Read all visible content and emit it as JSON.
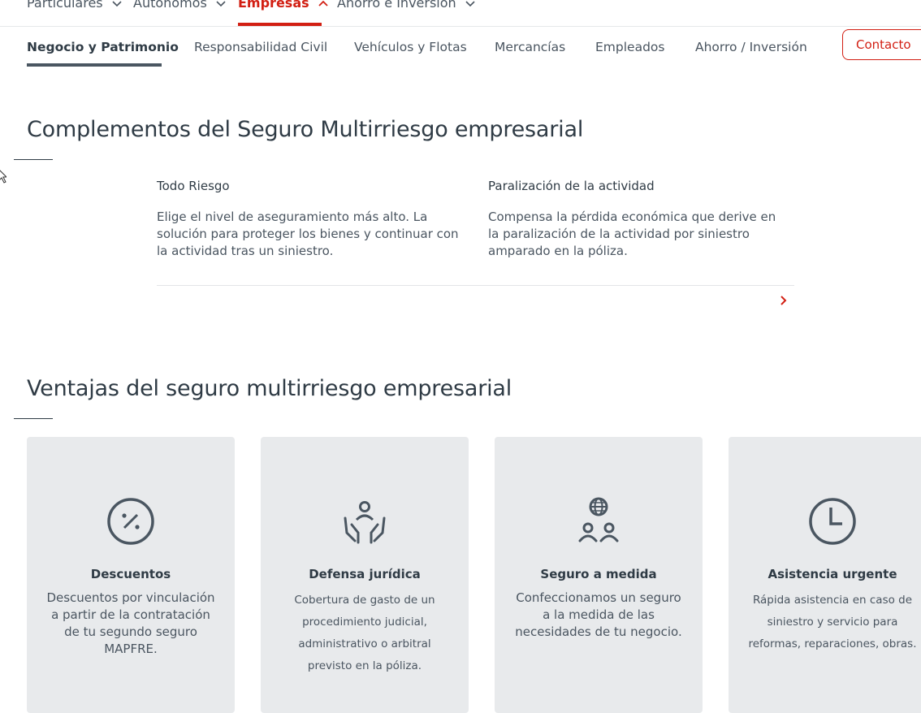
{
  "topnav": {
    "items": [
      {
        "label": "Particulares"
      },
      {
        "label": "Autónomos"
      },
      {
        "label": "Empresas"
      },
      {
        "label": "Ahorro e Inversión"
      }
    ]
  },
  "subnav": {
    "tabs": [
      {
        "label": "Negocio y Patrimonio"
      },
      {
        "label": "Responsabilidad Civil"
      },
      {
        "label": "Vehículos y Flotas"
      },
      {
        "label": "Mercancías"
      },
      {
        "label": "Empleados"
      },
      {
        "label": "Ahorro / Inversión"
      }
    ],
    "contact_label": "Contacto"
  },
  "complementos": {
    "heading": "Complementos del Seguro Multirriesgo empresarial",
    "items": [
      {
        "title": "Todo Riesgo",
        "desc": "Elige el nivel de aseguramiento más alto. La solución para proteger los bienes y continuar con la actividad tras un siniestro."
      },
      {
        "title": "Paralización de la actividad",
        "desc": "Compensa la pérdida económica que derive en la paralización de la actividad por siniestro amparado en la póliza."
      }
    ]
  },
  "ventajas": {
    "heading": "Ventajas del seguro multirriesgo empresarial",
    "cards": [
      {
        "icon": "percent-discount-icon",
        "title": "Descuentos",
        "desc": "Descuentos por vinculación a partir de la contratación de tu segundo seguro MAPFRE."
      },
      {
        "icon": "legal-defense-icon",
        "title": "Defensa jurídica",
        "desc": "Cobertura de gasto de un procedimiento judicial, administrativo o arbitral previsto en la póliza."
      },
      {
        "icon": "people-globe-icon",
        "title": "Seguro a medida",
        "desc": "Confeccionamos un seguro a la medida de las necesidades de tu negocio."
      },
      {
        "icon": "clock-icon",
        "title": "Asistencia urgente",
        "desc": "Rápida asistencia en caso de siniestro y servicio para reformas, reparaciones, obras."
      }
    ]
  },
  "colors": {
    "accent": "#d21f13",
    "text": "#2f3b45",
    "card_bg": "#e8eaec"
  }
}
